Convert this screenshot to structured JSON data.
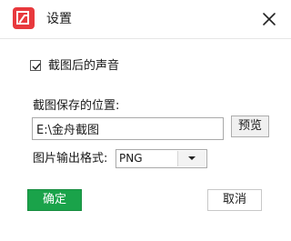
{
  "window": {
    "title": "设置",
    "app_icon": "app-logo-icon",
    "close_icon": "close-icon",
    "brand_color": "#e8393d"
  },
  "settings": {
    "sound": {
      "label": "截图后的声音",
      "checked": true
    },
    "save_path": {
      "label": "截图保存的位置:",
      "value": "E:\\金舟截图",
      "browse_label": "预览"
    },
    "format": {
      "label": "图片输出格式:",
      "selected": "PNG",
      "arrow_icon": "caret-down-icon"
    }
  },
  "actions": {
    "ok_label": "确定",
    "cancel_label": "取消",
    "ok_color": "#1aa34a"
  }
}
